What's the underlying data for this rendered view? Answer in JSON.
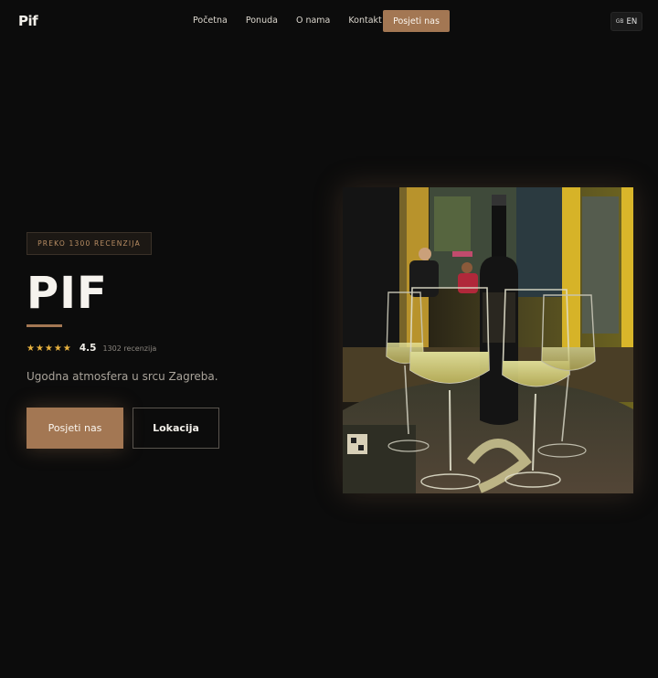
{
  "header": {
    "logo": "Pif",
    "nav": [
      {
        "label": "Početna"
      },
      {
        "label": "Ponuda"
      },
      {
        "label": "O nama"
      },
      {
        "label": "Kontakt"
      }
    ],
    "cta_label": "Posjeti nas",
    "lang": {
      "flag": "GB",
      "code": "EN"
    }
  },
  "hero": {
    "badge": "PREKO 1300 RECENZIJA",
    "title": "PIF",
    "rating": {
      "stars": "★★★★★",
      "score": "4.5",
      "reviews": "1302 recenzija"
    },
    "subtitle": "Ugodna atmosfera u srcu Zagreba.",
    "primary_button": "Posjeti nas",
    "secondary_button": "Lokacija"
  },
  "colors": {
    "background": "#0c0c0c",
    "accent": "#a37753",
    "star": "#e8b23f"
  }
}
